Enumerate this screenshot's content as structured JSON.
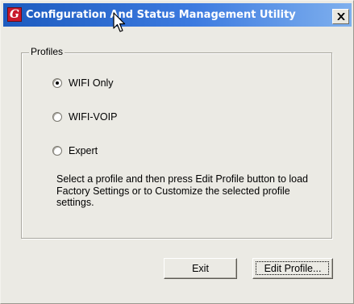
{
  "window": {
    "title": "Configuration And Status Management Utility",
    "app_icon_glyph": "G",
    "close_glyph": "close-icon"
  },
  "profiles": {
    "group_label": "Profiles",
    "options": [
      {
        "label": "WIFI Only",
        "selected": true
      },
      {
        "label": "WIFI-VOIP",
        "selected": false
      },
      {
        "label": "Expert",
        "selected": false
      }
    ],
    "help_text": "Select a profile and then press Edit Profile button to load Factory Settings or to Customize the selected profile settings."
  },
  "buttons": {
    "exit_label": "Exit",
    "edit_profile_label": "Edit Profile..."
  },
  "colors": {
    "titlebar_start": "#1d5bbf",
    "titlebar_end": "#7fb0ee",
    "app_icon": "#c8182c",
    "face": "#ebeae4"
  }
}
